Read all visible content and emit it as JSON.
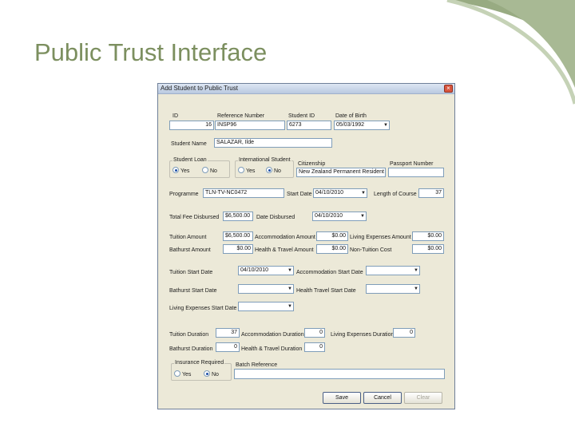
{
  "slide": {
    "title": "Public Trust Interface"
  },
  "dialog": {
    "title": "Add Student to Public Trust",
    "close_glyph": "×",
    "row1": {
      "id_label": "ID",
      "id_value": "16",
      "reference_label": "Reference Number",
      "reference_value": "INSP96",
      "student_id_label": "Student ID",
      "student_id_value": "6273",
      "dob_label": "Date of Birth",
      "dob_value": "05/03/1992"
    },
    "student_name": {
      "label": "Student Name",
      "value": "SALAZAR, Ilde"
    },
    "student_loan": {
      "label": "Student Loan",
      "options": [
        "Yes",
        "No"
      ],
      "selected": "Yes"
    },
    "international": {
      "label": "International Student",
      "options": [
        "Yes",
        "No"
      ],
      "selected": "No"
    },
    "citizenship": {
      "label": "Citizenship",
      "value": "New Zealand Permanent Resident"
    },
    "passport": {
      "label": "Passport Number",
      "value": ""
    },
    "programme": {
      "label": "Programme",
      "value": "TLN-TV-NC0472",
      "start_date_label": "Start Date",
      "start_date_value": "04/10/2010",
      "length_label": "Length of Course",
      "length_value": "37"
    },
    "total_fee": {
      "label": "Total Fee Disbursed",
      "value": "$6,500.00",
      "date_label": "Date Disbursed",
      "date_value": "04/10/2010"
    },
    "amounts": {
      "tuition_label": "Tuition Amount",
      "tuition_value": "$6,500.00",
      "accommodation_label": "Accommodation Amount",
      "accommodation_value": "$0.00",
      "living_label": "Living Expenses Amount",
      "living_value": "$0.00",
      "bathurst_label": "Bathurst Amount",
      "bathurst_value": "$0.00",
      "health_label": "Health & Travel Amount",
      "health_value": "$0.00",
      "nontuition_label": "Non-Tuition Cost",
      "nontuition_value": "$0.00"
    },
    "dates": {
      "tuition_start_label": "Tuition Start Date",
      "tuition_start_value": "04/10/2010",
      "accommodation_start_label": "Accommodation Start Date",
      "accommodation_start_value": "",
      "bathurst_start_label": "Bathurst Start Date",
      "bathurst_start_value": "",
      "health_start_label": "Health Travel Start Date",
      "health_start_value": "",
      "living_start_label": "Living Expenses Start Date",
      "living_start_value": ""
    },
    "durations": {
      "tuition_label": "Tuition Duration",
      "tuition_value": "37",
      "accommodation_label": "Accommodation Duration",
      "accommodation_value": "0",
      "living_label": "Living Expenses Duration",
      "living_value": "0",
      "bathurst_label": "Bathurst Duration",
      "bathurst_value": "0",
      "health_label": "Health & Travel Duration",
      "health_value": "0"
    },
    "insurance": {
      "label": "Insurance Required",
      "options": [
        "Yes",
        "No"
      ],
      "selected": "No"
    },
    "batch": {
      "label": "Batch Reference",
      "value": ""
    },
    "buttons": {
      "save": "Save",
      "cancel": "Cancel",
      "clear": "Clear"
    },
    "dropdown_glyph": "▼"
  },
  "colors": {
    "title_text": "#7c8f5f",
    "deco_green": "#98ab82",
    "window_face": "#ece9d8",
    "field_border": "#7f9db9"
  }
}
